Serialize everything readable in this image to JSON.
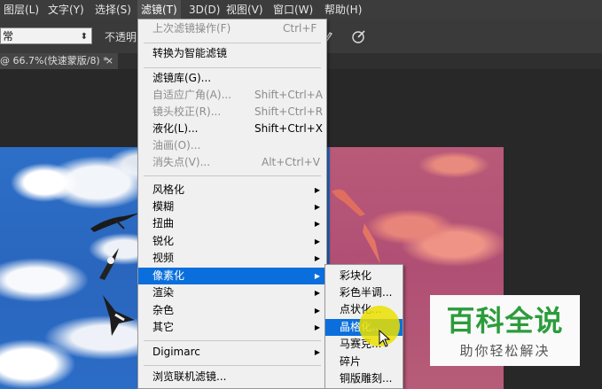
{
  "menubar": {
    "items": [
      {
        "label": "图层(L)"
      },
      {
        "label": "文字(Y)"
      },
      {
        "label": "选择(S)"
      },
      {
        "label": "滤镜(T)"
      },
      {
        "label": "3D(D)"
      },
      {
        "label": "视图(V)"
      },
      {
        "label": "窗口(W)"
      },
      {
        "label": "帮助(H)"
      }
    ]
  },
  "options": {
    "mode_value": "常",
    "opacity_label": "不透明",
    "arrow": "⬍"
  },
  "document_tab": {
    "label": "@ 66.7%(快速蒙版/8) *",
    "close": "×"
  },
  "filter_menu": {
    "items": [
      {
        "label": "上次滤镜操作(F)",
        "shortcut": "Ctrl+F",
        "state": "disabled"
      },
      {
        "label": "转换为智能滤镜",
        "shortcut": "",
        "state": "normal"
      },
      {
        "label": "滤镜库(G)...",
        "shortcut": "",
        "state": "normal"
      },
      {
        "label": "自适应广角(A)...",
        "shortcut": "Shift+Ctrl+A",
        "state": "disabled"
      },
      {
        "label": "镜头校正(R)...",
        "shortcut": "Shift+Ctrl+R",
        "state": "disabled"
      },
      {
        "label": "液化(L)...",
        "shortcut": "Shift+Ctrl+X",
        "state": "normal"
      },
      {
        "label": "油画(O)...",
        "shortcut": "",
        "state": "disabled"
      },
      {
        "label": "消失点(V)...",
        "shortcut": "Alt+Ctrl+V",
        "state": "disabled"
      },
      {
        "label": "风格化",
        "shortcut": "",
        "state": "normal",
        "submenu": true
      },
      {
        "label": "模糊",
        "shortcut": "",
        "state": "normal",
        "submenu": true
      },
      {
        "label": "扭曲",
        "shortcut": "",
        "state": "normal",
        "submenu": true
      },
      {
        "label": "锐化",
        "shortcut": "",
        "state": "normal",
        "submenu": true
      },
      {
        "label": "视频",
        "shortcut": "",
        "state": "normal",
        "submenu": true
      },
      {
        "label": "像素化",
        "shortcut": "",
        "state": "selected",
        "submenu": true
      },
      {
        "label": "渲染",
        "shortcut": "",
        "state": "normal",
        "submenu": true
      },
      {
        "label": "杂色",
        "shortcut": "",
        "state": "normal",
        "submenu": true
      },
      {
        "label": "其它",
        "shortcut": "",
        "state": "normal",
        "submenu": true
      },
      {
        "label": "Digimarc",
        "shortcut": "",
        "state": "normal",
        "submenu": true
      },
      {
        "label": "浏览联机滤镜...",
        "shortcut": "",
        "state": "normal"
      }
    ]
  },
  "pixelate_submenu": {
    "items": [
      {
        "label": "彩块化",
        "state": "normal"
      },
      {
        "label": "彩色半调...",
        "state": "normal"
      },
      {
        "label": "点状化...",
        "state": "normal"
      },
      {
        "label": "晶格化...",
        "state": "selected"
      },
      {
        "label": "马赛克...",
        "state": "normal"
      },
      {
        "label": "碎片",
        "state": "normal"
      },
      {
        "label": "铜版雕刻...",
        "state": "normal"
      }
    ]
  },
  "watermark": {
    "title": "百科全说",
    "subtitle": "助你轻松解决"
  },
  "icons": {
    "submenu_arrow": "▶",
    "cursor": "arrow-cursor-icon"
  },
  "colors": {
    "menu_bg": "#f0f0f0",
    "selected_bg": "#0a6fdc",
    "app_bg": "#282828",
    "watermark_green": "#2b9c3b"
  }
}
